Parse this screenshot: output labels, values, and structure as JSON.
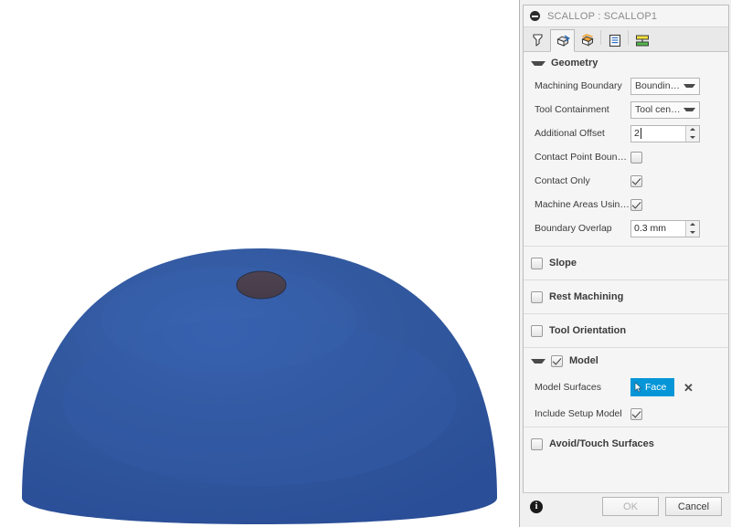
{
  "window": {
    "title": "SCALLOP : SCALLOP1",
    "collapse_icon": "collapse-circle-icon"
  },
  "tabs": [
    {
      "id": "tool",
      "icon": "tool-icon",
      "active": false
    },
    {
      "id": "geometry",
      "icon": "geometry-cube-icon",
      "active": true
    },
    {
      "id": "heights",
      "icon": "heights-cube-icon",
      "active": false
    },
    {
      "id": "passes",
      "icon": "passes-list-icon",
      "active": false
    },
    {
      "id": "linking",
      "icon": "linking-icon",
      "active": false
    }
  ],
  "geometry": {
    "title": "Geometry",
    "expanded": true,
    "rows": [
      {
        "label": "Machining Boundary",
        "type": "dropdown",
        "value": "Bounding box"
      },
      {
        "label": "Tool Containment",
        "type": "dropdown",
        "value": "Tool center c..."
      },
      {
        "label": "Additional Offset",
        "type": "spinner",
        "value": "2"
      },
      {
        "label": "Contact Point Boundi...",
        "type": "checkbox",
        "checked": false
      },
      {
        "label": "Contact Only",
        "type": "checkbox",
        "checked": true
      },
      {
        "label": "Machine Areas Using...",
        "type": "checkbox",
        "checked": true
      },
      {
        "label": "Boundary Overlap",
        "type": "spinner",
        "value": "0.3 mm"
      }
    ]
  },
  "collapsed_sections": [
    {
      "label": "Slope",
      "checked": false
    },
    {
      "label": "Rest Machining",
      "checked": false
    },
    {
      "label": "Tool Orientation",
      "checked": false
    }
  ],
  "model": {
    "title": "Model",
    "checked": true,
    "expanded": true,
    "model_surfaces_label": "Model Surfaces",
    "face_button_label": "Face",
    "face_button_color": "#0696d7",
    "clear_label": "✕",
    "include_setup_model_label": "Include Setup Model",
    "include_setup_model_checked": true
  },
  "avoid_touch": {
    "label": "Avoid/Touch Surfaces",
    "checked": false
  },
  "footer": {
    "info_label": "i",
    "ok_label": "OK",
    "cancel_label": "Cancel",
    "ok_disabled": true
  },
  "viewport": {
    "model_name": "blue-dome-model",
    "body_color": "#2e55a3",
    "top_face_color": "#4a3f4e"
  }
}
